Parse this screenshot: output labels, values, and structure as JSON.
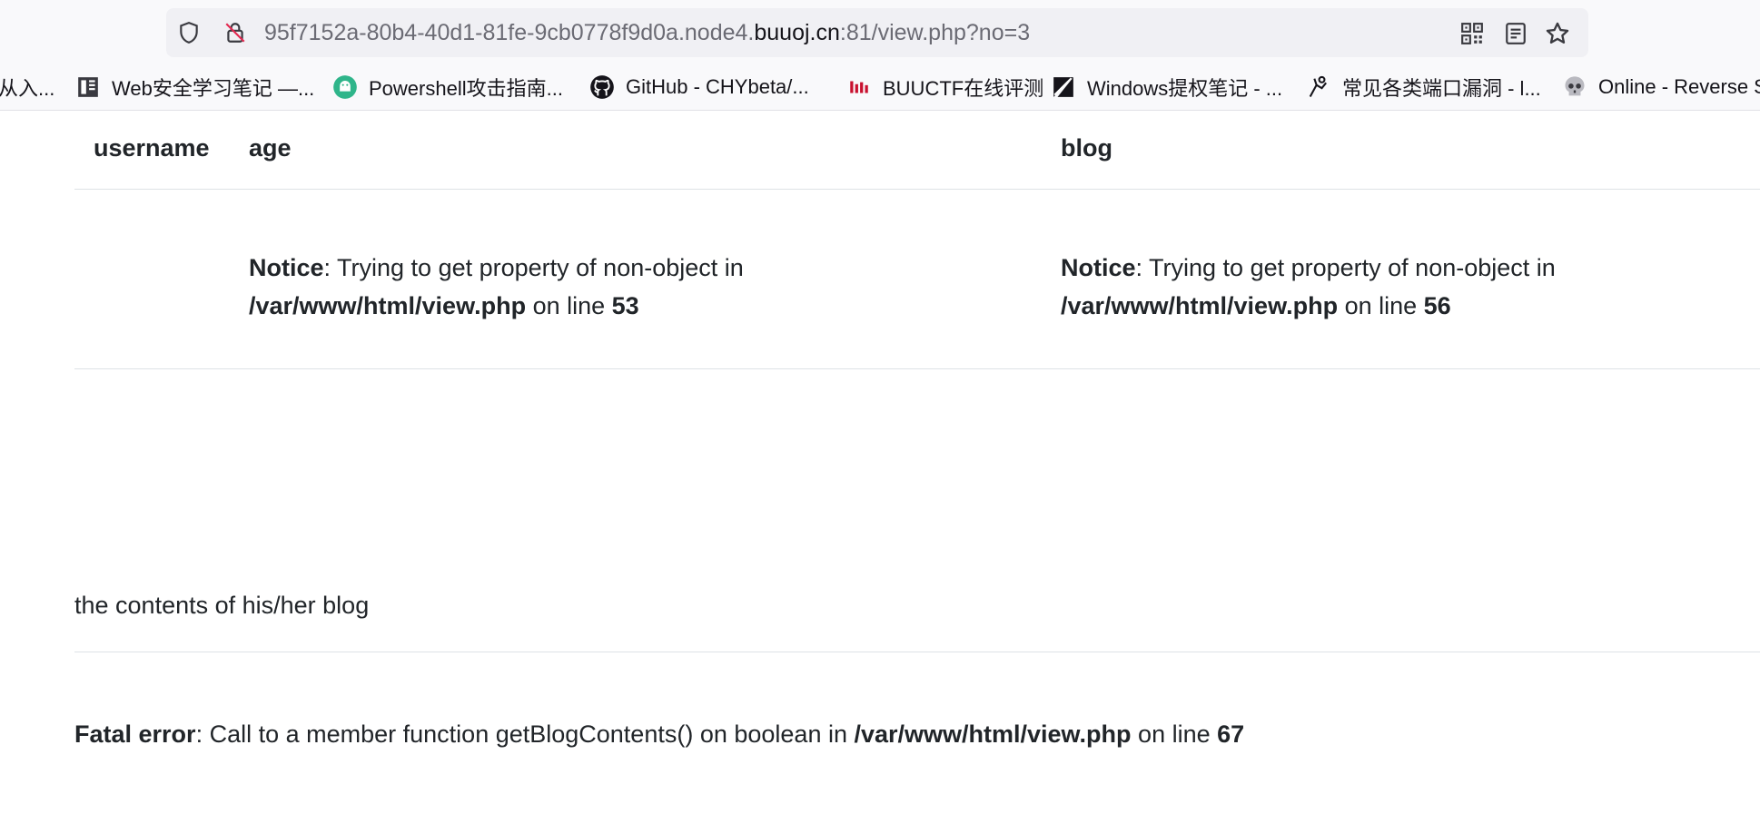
{
  "browser": {
    "url": {
      "prefix": "95f7152a-80b4-40d1-81fe-9cb0778f9d0a.node4.",
      "domain": "buuoj.cn",
      "suffix": ":81/view.php?no=3"
    },
    "icons": {
      "shield": "shield-icon",
      "insecure_lock": "lock-slash-icon",
      "qr": "qr-code-icon",
      "reader": "reader-view-icon",
      "star": "bookmark-star-icon"
    },
    "bookmarks": [
      {
        "label": "从入...",
        "icon": "none"
      },
      {
        "label": "Web安全学习笔记 —...",
        "icon": "book-icon"
      },
      {
        "label": "Powershell攻击指南...",
        "icon": "android-icon"
      },
      {
        "label": "GitHub - CHYbeta/...",
        "icon": "github-icon"
      },
      {
        "label": "BUUCTF在线评测",
        "icon": "buuctf-icon"
      },
      {
        "label": "Windows提权笔记 - ...",
        "icon": "slash-icon"
      },
      {
        "label": "常见各类端口漏洞 - l...",
        "icon": "figure-icon"
      },
      {
        "label": "Online - Reverse S",
        "icon": "skull-icon"
      }
    ]
  },
  "table": {
    "headers": {
      "username": "username",
      "age": "age",
      "blog": "blog"
    },
    "row": {
      "age_notice": {
        "label": "Notice",
        "msg": ": Trying to get property of non-object in ",
        "path": "/var/www/html/view.php",
        "on_line": " on line ",
        "line": "53"
      },
      "blog_notice": {
        "label": "Notice",
        "msg": ": Trying to get property of non-object in ",
        "path": "/var/www/html/view.php",
        "on_line": " on line ",
        "line": "56"
      }
    }
  },
  "blog_contents_text": "the contents of his/her blog",
  "fatal": {
    "label": "Fatal error",
    "msg": ": Call to a member function getBlogContents() on boolean in ",
    "path": "/var/www/html/view.php",
    "on_line": " on line ",
    "line": "67"
  }
}
